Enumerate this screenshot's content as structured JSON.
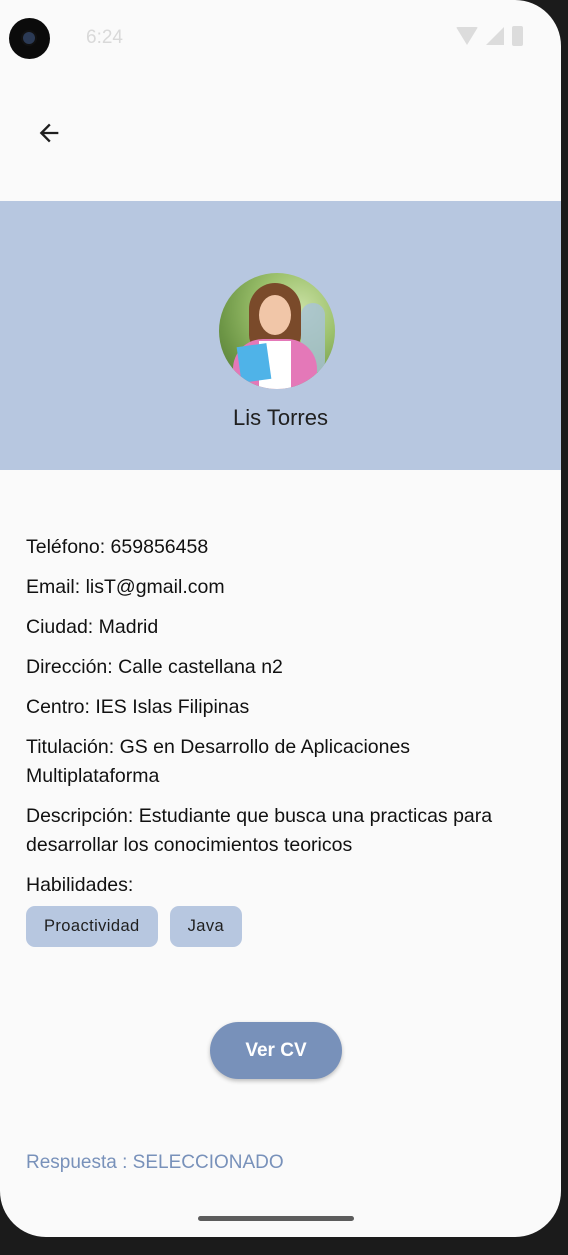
{
  "status_bar": {
    "time": "6:24"
  },
  "profile": {
    "name": "Lis Torres"
  },
  "details": {
    "telefono": "Teléfono: 659856458",
    "email": "Email: lisT@gmail.com",
    "ciudad": "Ciudad: Madrid",
    "direccion": "Dirección: Calle castellana n2",
    "centro": "Centro: IES Islas Filipinas",
    "titulacion": "Titulación: GS en Desarrollo de Aplicaciones Multiplataforma",
    "descripcion": "Descripción: Estudiante que busca una practicas para desarrollar los conocimientos teoricos",
    "habilidades_label": "Habilidades:"
  },
  "skills": [
    "Proactividad",
    "Java"
  ],
  "actions": {
    "cv_button": "Ver CV"
  },
  "response": {
    "text": "Respuesta : SELECCIONADO"
  },
  "colors": {
    "header_bg": "#b7c7e0",
    "accent": "#7891ba",
    "chip_bg": "#b7c7e0"
  },
  "icons": {
    "back": "arrow-left-icon",
    "camera": "camera-icon",
    "wifi": "wifi-icon",
    "signal": "signal-icon",
    "battery": "battery-icon"
  }
}
